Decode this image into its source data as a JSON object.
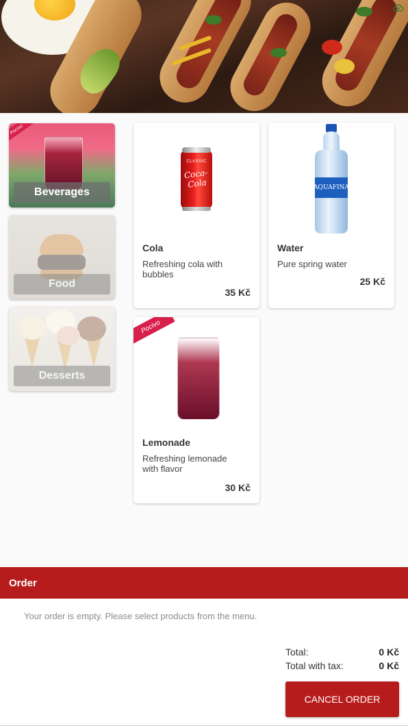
{
  "categories": [
    {
      "label": "Beverages",
      "active": true
    },
    {
      "label": "Food",
      "active": false
    },
    {
      "label": "Desserts",
      "active": false
    }
  ],
  "products": [
    {
      "name": "Cola",
      "description": "Refreshing cola with bubbles",
      "price": "35 Kč",
      "brand_text": "Coca-Cola",
      "brand_top": "CLASSIC"
    },
    {
      "name": "Water",
      "description": "Pure spring water",
      "price": "25 Kč",
      "brand_text": "AQUAFINA"
    },
    {
      "name": "Lemonade",
      "description": "Refreshing lemonade with flavor",
      "price": "30 Kč",
      "banner_text": "Pocivo"
    }
  ],
  "order": {
    "title": "Order",
    "empty_message": "Your order is empty. Please select products from the menu.",
    "total_label": "Total:",
    "total_value": "0 Kč",
    "total_tax_label": "Total with tax:",
    "total_tax_value": "0 Kč",
    "cancel_label": "CANCEL ORDER"
  },
  "colors": {
    "accent": "#b71c1c",
    "status_icon": "#2e7d32"
  },
  "icons": {
    "status": "cloud-icon"
  }
}
